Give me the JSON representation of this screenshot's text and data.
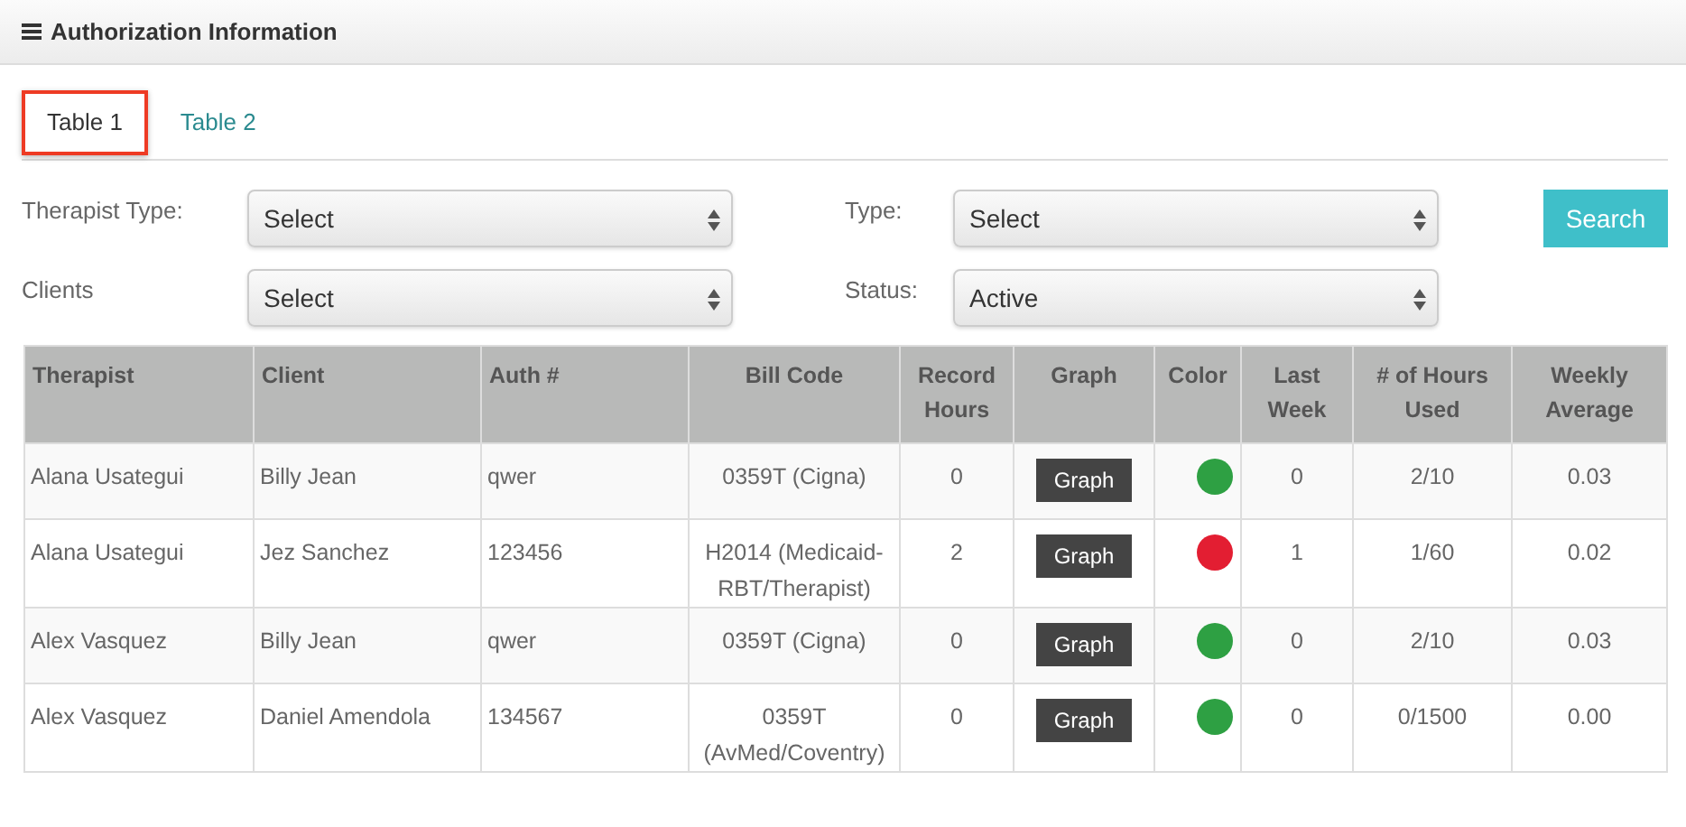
{
  "panel": {
    "title": "Authorization Information"
  },
  "tabs": [
    {
      "label": "Table 1",
      "selected": true,
      "highlighted": true
    },
    {
      "label": "Table 2",
      "selected": false,
      "highlighted": false
    }
  ],
  "filters": [
    {
      "label": "Therapist Type:",
      "value": "Select"
    },
    {
      "label": "Type:",
      "value": "Select"
    },
    {
      "label": "Clients",
      "value": "Select"
    },
    {
      "label": "Status:",
      "value": "Active"
    }
  ],
  "search_button": "Search",
  "table": {
    "columns": [
      "Therapist",
      "Client",
      "Auth #",
      "Bill Code",
      "Record Hours",
      "Graph",
      "Color",
      "Last Week",
      "# of Hours Used",
      "Weekly Average"
    ],
    "rows": [
      {
        "therapist": "Alana Usategui",
        "client": "Billy Jean",
        "auth": "qwer",
        "bill_code": "0359T (Cigna)",
        "record_hours": "0",
        "graph": "Graph",
        "color": "#2ea043",
        "last_week": "0",
        "hours_used": "2/10",
        "weekly_average": "0.03"
      },
      {
        "therapist": "Alana Usategui",
        "client": "Jez Sanchez",
        "auth": "123456",
        "bill_code": "H2014 (Medicaid-RBT/Therapist)",
        "record_hours": "2",
        "graph": "Graph",
        "color": "#e31e32",
        "last_week": "1",
        "hours_used": "1/60",
        "weekly_average": "0.02"
      },
      {
        "therapist": "Alex Vasquez",
        "client": "Billy Jean",
        "auth": "qwer",
        "bill_code": "0359T (Cigna)",
        "record_hours": "0",
        "graph": "Graph",
        "color": "#2ea043",
        "last_week": "0",
        "hours_used": "2/10",
        "weekly_average": "0.03"
      },
      {
        "therapist": "Alex Vasquez",
        "client": "Daniel Amendola",
        "auth": "134567",
        "bill_code": "0359T (AvMed/Coventry)",
        "record_hours": "0",
        "graph": "Graph",
        "color": "#2ea043",
        "last_week": "0",
        "hours_used": "0/1500",
        "weekly_average": "0.00"
      }
    ]
  }
}
